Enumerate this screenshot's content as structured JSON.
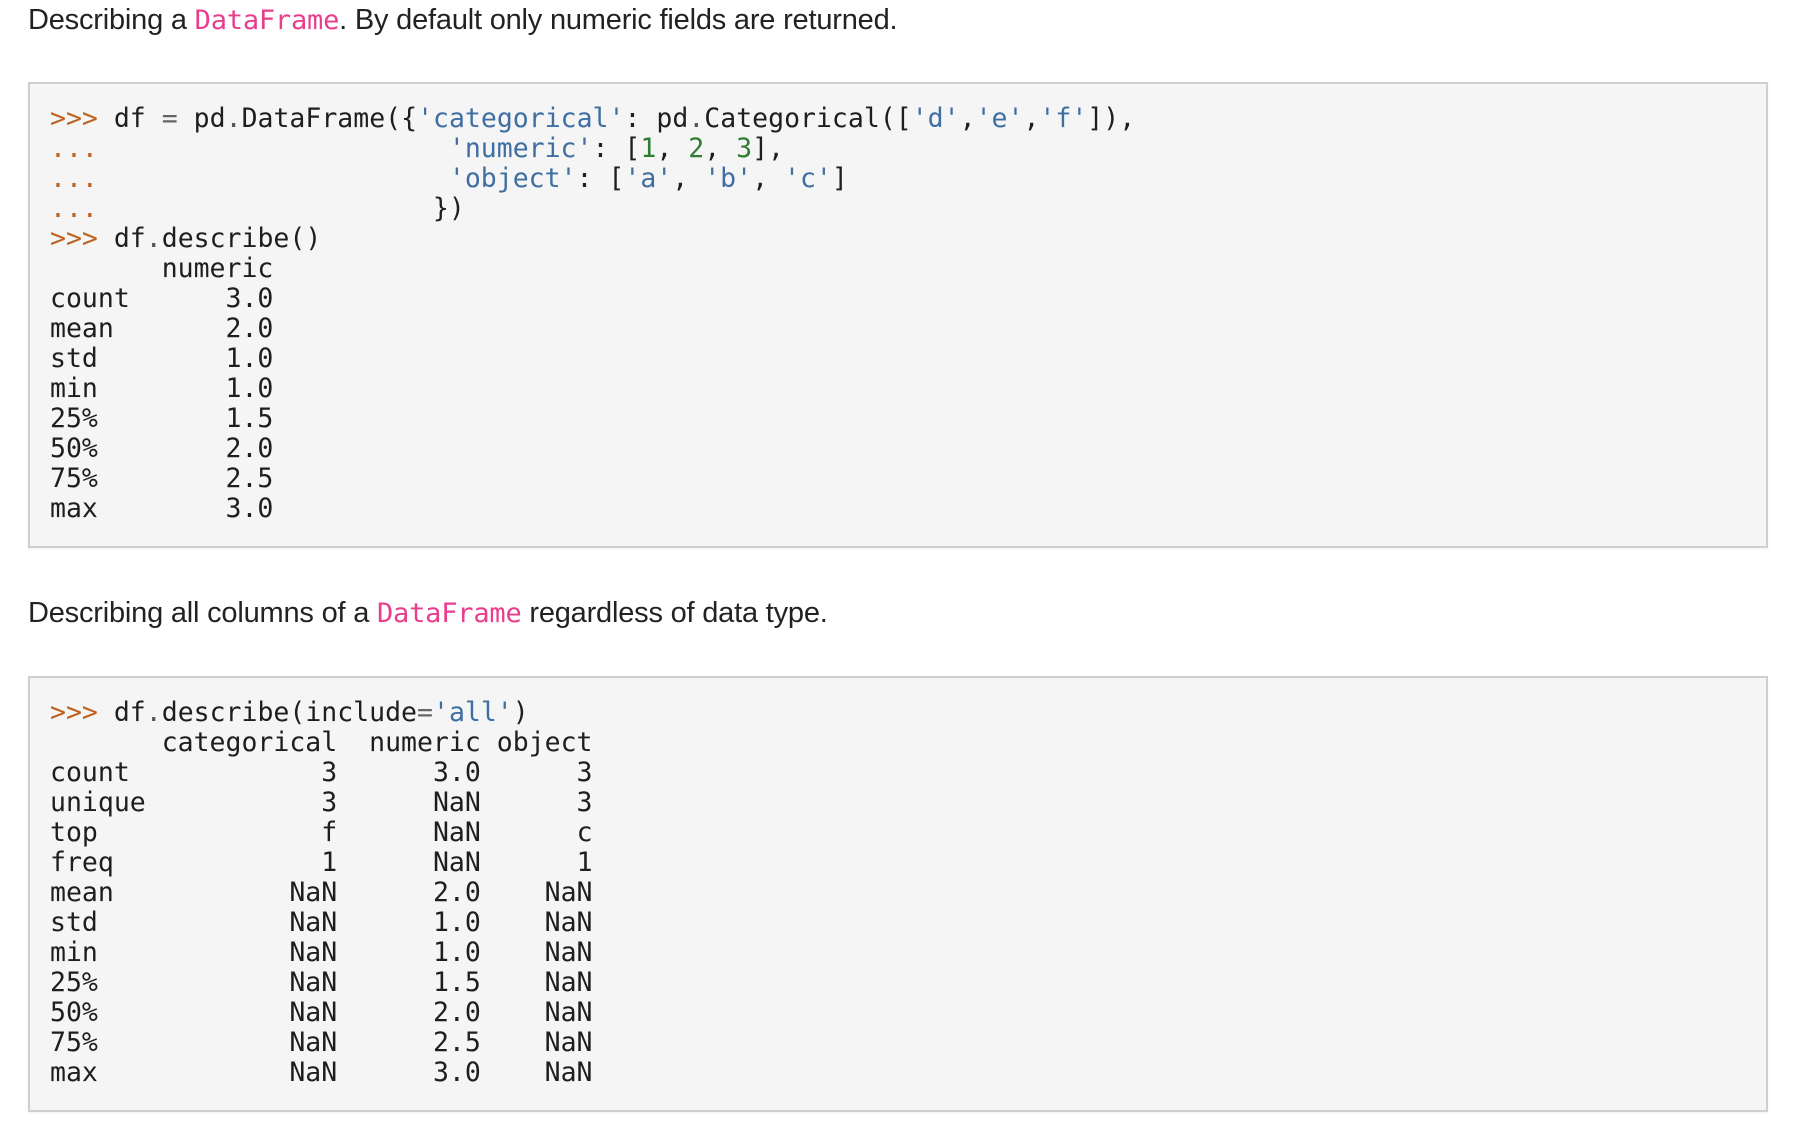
{
  "sections": [
    {
      "text_before": "Describing a ",
      "code_term": "DataFrame",
      "text_after": ". By default only numeric fields are returned."
    },
    {
      "text_before": "Describing all columns of a ",
      "code_term": "DataFrame",
      "text_after": " regardless of data type."
    }
  ],
  "block1": {
    "prompt": ">>>",
    "continuation": "...",
    "line1": {
      "a": "df",
      "eq": "=",
      "b": "pd",
      "c": "DataFrame({",
      "key": "'categorical'",
      "colon": ": ",
      "d": "pd",
      "e": "Categorical([",
      "v1": "'d'",
      "v2": "'e'",
      "v3": "'f'",
      "end": "]),"
    },
    "line2": {
      "key": "'numeric'",
      "colon": ": [",
      "n1": "1",
      "n2": "2",
      "n3": "3",
      "end": "],"
    },
    "line3": {
      "key": "'object'",
      "colon": ": [",
      "v1": "'a'",
      "v2": "'b'",
      "v3": "'c'",
      "end": "]"
    },
    "line4": "})",
    "line5": {
      "a": "df",
      "b": "describe()"
    },
    "table": {
      "header": "numeric",
      "rows": [
        [
          "count",
          "3.0"
        ],
        [
          "mean",
          "2.0"
        ],
        [
          "std",
          "1.0"
        ],
        [
          "min",
          "1.0"
        ],
        [
          "25%",
          "1.5"
        ],
        [
          "50%",
          "2.0"
        ],
        [
          "75%",
          "2.5"
        ],
        [
          "max",
          "3.0"
        ]
      ]
    }
  },
  "block2": {
    "prompt": ">>>",
    "call": {
      "a": "df",
      "b": "describe(include",
      "eq": "=",
      "arg": "'all'",
      "end": ")"
    },
    "table": {
      "headers": [
        "categorical",
        "numeric",
        "object"
      ],
      "rows": [
        [
          "count",
          "3",
          "3.0",
          "3"
        ],
        [
          "unique",
          "3",
          "NaN",
          "3"
        ],
        [
          "top",
          "f",
          "NaN",
          "c"
        ],
        [
          "freq",
          "1",
          "NaN",
          "1"
        ],
        [
          "mean",
          "NaN",
          "2.0",
          "NaN"
        ],
        [
          "std",
          "NaN",
          "1.0",
          "NaN"
        ],
        [
          "min",
          "NaN",
          "1.0",
          "NaN"
        ],
        [
          "25%",
          "NaN",
          "1.5",
          "NaN"
        ],
        [
          "50%",
          "NaN",
          "2.0",
          "NaN"
        ],
        [
          "75%",
          "NaN",
          "2.5",
          "NaN"
        ],
        [
          "max",
          "NaN",
          "3.0",
          "NaN"
        ]
      ]
    }
  }
}
